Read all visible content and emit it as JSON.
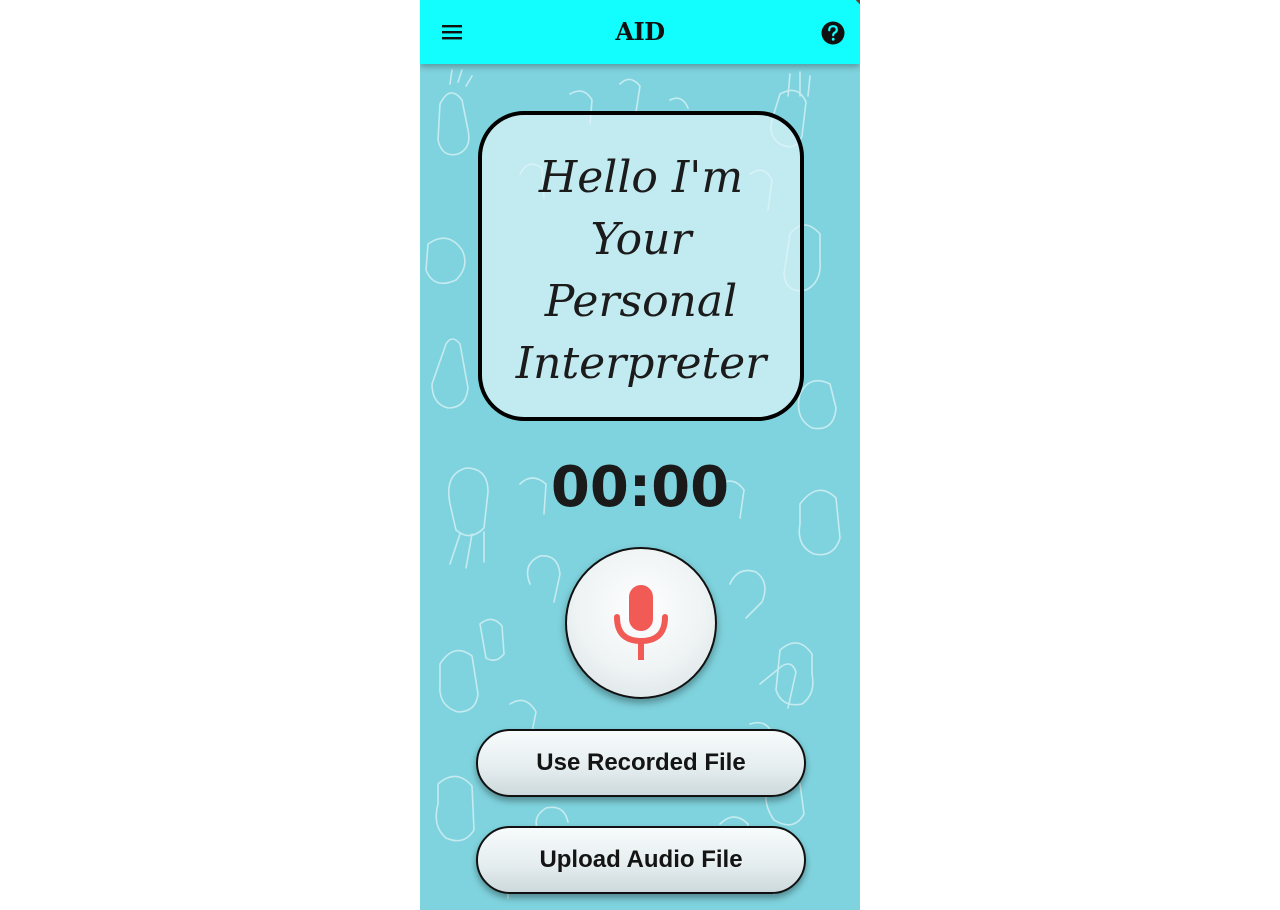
{
  "app_bar": {
    "title": "AID",
    "menu_icon": "hamburger-menu-icon",
    "help_icon": "help-circle-icon",
    "background_color": "#12FDFD"
  },
  "greeting": {
    "lines": [
      "Hello I'm",
      "Your",
      "Personal",
      "Interpreter"
    ]
  },
  "timer": {
    "value": "00:00"
  },
  "record_button": {
    "icon": "microphone-icon",
    "icon_color": "#F25A56"
  },
  "actions": {
    "use_recorded_label": "Use Recorded File",
    "upload_audio_label": "Upload Audio File"
  },
  "theme": {
    "page_background": "#7FD3DE"
  }
}
